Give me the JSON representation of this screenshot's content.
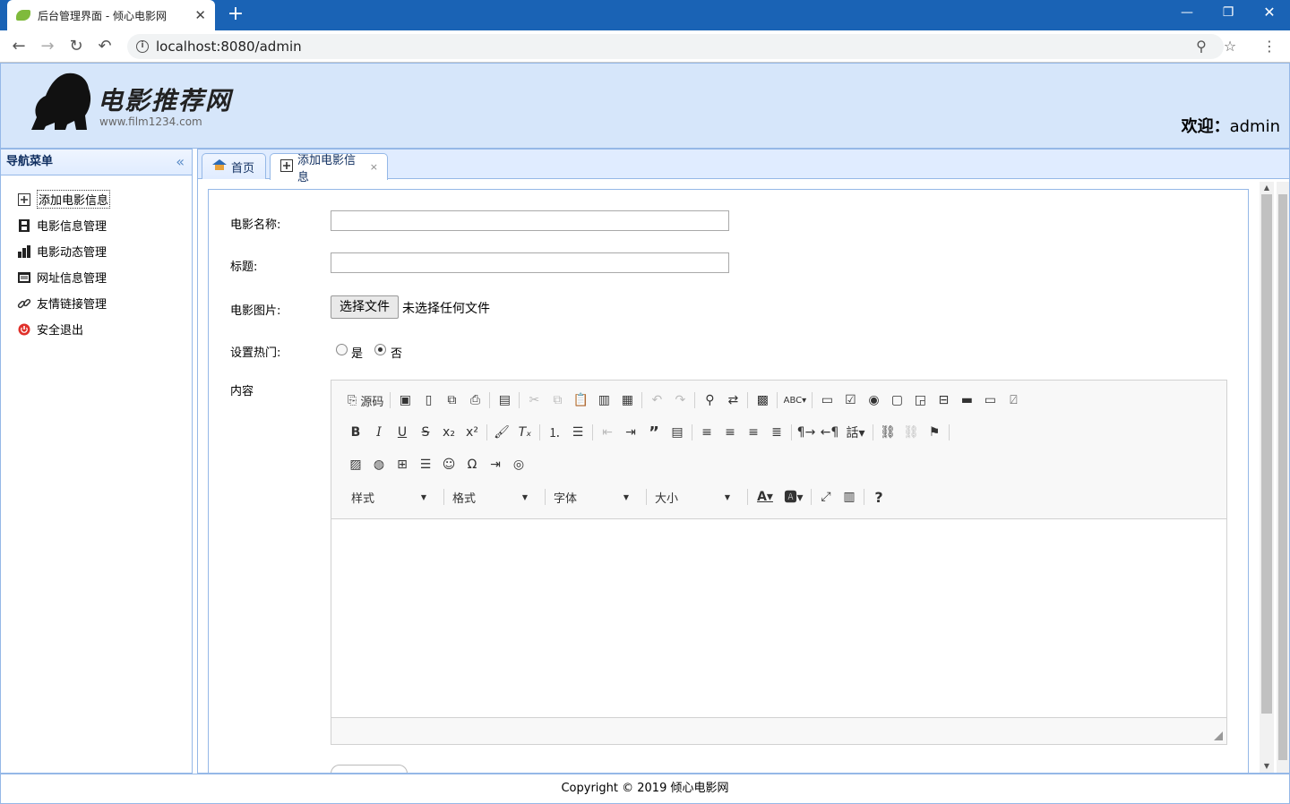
{
  "browser": {
    "tab_title": "后台管理界面 - 倾心电影网",
    "tab_close": "✕",
    "new_tab": "+",
    "url": "localhost:8080/admin"
  },
  "header": {
    "logo_title": "电影推荐网",
    "logo_url": "www.film1234.com",
    "welcome_label": "欢迎：",
    "username": "admin"
  },
  "sidebar": {
    "title": "导航菜单",
    "items": [
      {
        "label": "添加电影信息",
        "icon": "add-icon"
      },
      {
        "label": "电影信息管理",
        "icon": "film-icon"
      },
      {
        "label": "电影动态管理",
        "icon": "chart-icon"
      },
      {
        "label": "网址信息管理",
        "icon": "window-icon"
      },
      {
        "label": "友情链接管理",
        "icon": "link-icon"
      },
      {
        "label": "安全退出",
        "icon": "exit-icon"
      }
    ]
  },
  "tabs": [
    {
      "label": "首页",
      "icon": "home-icon"
    },
    {
      "label": "添加电影信息",
      "icon": "add-icon",
      "close": "×"
    }
  ],
  "form": {
    "name_label": "电影名称:",
    "name_value": "",
    "title_label": "标题:",
    "title_value": "",
    "image_label": "电影图片:",
    "file_button": "选择文件",
    "file_status": "未选择任何文件",
    "hot_label": "设置热门:",
    "hot_yes": "是",
    "hot_no": "否",
    "hot_selected": "否",
    "content_label": "内容"
  },
  "editor": {
    "source_label": "源码",
    "combos": [
      "样式",
      "格式",
      "字体",
      "大小"
    ]
  },
  "footer": {
    "copyright": "Copyright © 2019 倾心电影网"
  },
  "colors": {
    "chrome_blue": "#1a63b5",
    "header_bg": "#d6e6fa",
    "panel_border": "#95b8e7"
  }
}
